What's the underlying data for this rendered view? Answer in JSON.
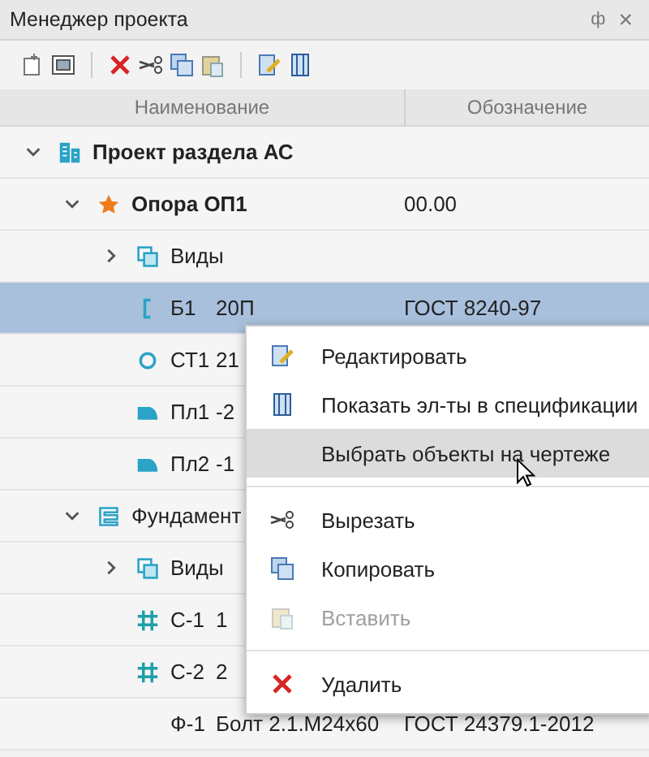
{
  "panel": {
    "title": "Менеджер проекта",
    "pin": "ф",
    "close": "×"
  },
  "toolbar": [
    {
      "kind": "new"
    },
    {
      "kind": "window"
    },
    {
      "kind": "sep"
    },
    {
      "kind": "delete"
    },
    {
      "kind": "cut"
    },
    {
      "kind": "copy"
    },
    {
      "kind": "paste"
    },
    {
      "kind": "sep"
    },
    {
      "kind": "edit"
    },
    {
      "kind": "spec"
    }
  ],
  "columns": [
    "Наименование",
    "Обозначение"
  ],
  "tree": [
    {
      "kind": "building",
      "name": "Проект раздела АС",
      "bold": true,
      "expanded": true,
      "selected": false,
      "children": [
        {
          "kind": "star",
          "name": "Опора ОП1",
          "bold": true,
          "designation": "00.00",
          "expanded": true,
          "selected": false,
          "children": [
            {
              "kind": "views",
              "name": "Виды",
              "expanded": false,
              "selected": false
            },
            {
              "kind": "beam",
              "name": "Б1",
              "detail": "20П",
              "designation": "ГОСТ 8240-97",
              "selected": true
            },
            {
              "kind": "circle",
              "name": "СТ1",
              "detail": "21",
              "selected": false
            },
            {
              "kind": "plate",
              "name": "Пл1",
              "detail": "-2",
              "selected": false
            },
            {
              "kind": "plate",
              "name": "Пл2",
              "detail": "-1",
              "selected": false
            }
          ]
        },
        {
          "kind": "foundation",
          "name": "Фундамент",
          "expanded": true,
          "selected": false,
          "children": [
            {
              "kind": "views",
              "name": "Виды",
              "expanded": false,
              "selected": false
            },
            {
              "kind": "grid",
              "name": "С-1",
              "detail": "1",
              "selected": false
            },
            {
              "kind": "grid",
              "name": "С-2",
              "detail": "2",
              "selected": false
            },
            {
              "kind": "plain",
              "name": "Ф-1",
              "detail": "Болт 2.1.М24x60",
              "designation": "ГОСТ 24379.1-2012",
              "selected": false
            }
          ]
        }
      ]
    }
  ],
  "context_menu": [
    {
      "kind": "edit",
      "label": "Редактировать",
      "selected": false,
      "disabled": false
    },
    {
      "kind": "spec",
      "label": "Показать эл-ты в спецификации",
      "selected": false,
      "disabled": false
    },
    {
      "kind": "plain",
      "label": "Выбрать объекты на чертеже",
      "selected": true,
      "disabled": false
    },
    {
      "kind": "separator"
    },
    {
      "kind": "cut",
      "label": "Вырезать",
      "selected": false,
      "disabled": false
    },
    {
      "kind": "copy",
      "label": "Копировать",
      "selected": false,
      "disabled": false
    },
    {
      "kind": "paste",
      "label": "Вставить",
      "selected": false,
      "disabled": true
    },
    {
      "kind": "separator"
    },
    {
      "kind": "delete",
      "label": "Удалить",
      "selected": false,
      "disabled": false
    }
  ]
}
